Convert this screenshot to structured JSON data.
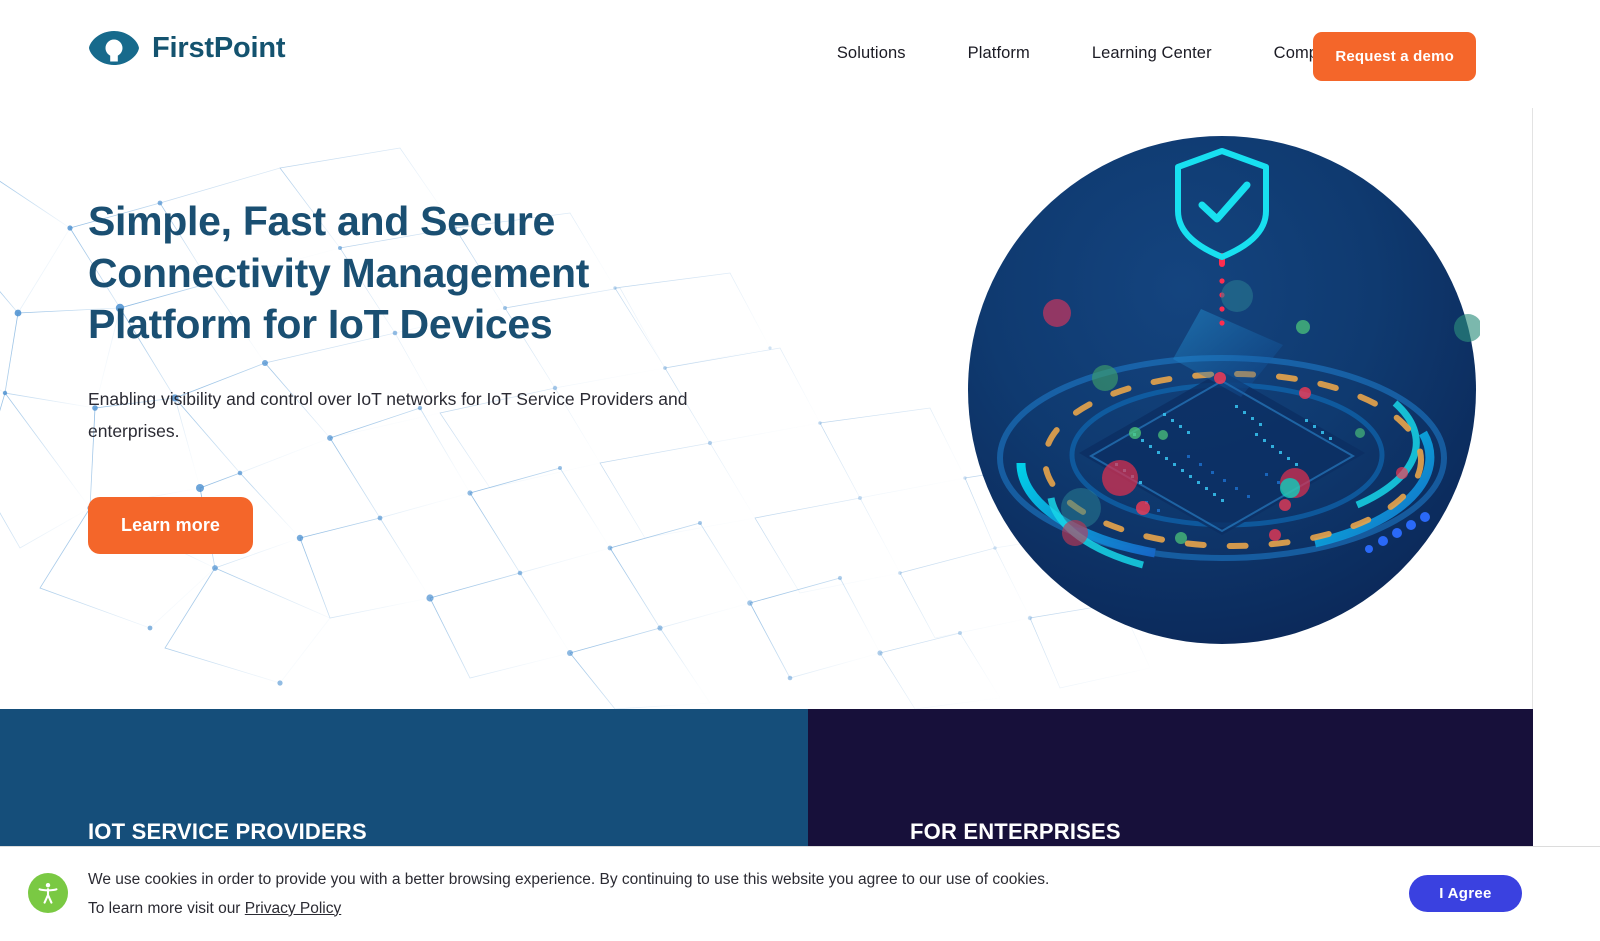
{
  "brand": {
    "name": "FirstPoint",
    "logo_icon": "eye-lens-icon",
    "color": "#14536f"
  },
  "header": {
    "nav_items": [
      {
        "label": "Solutions"
      },
      {
        "label": "Platform"
      },
      {
        "label": "Learning Center"
      },
      {
        "label": "Company"
      }
    ],
    "cta_label": "Request a demo",
    "cta_color": "#f4662a"
  },
  "hero": {
    "title_lines": [
      "Simple, Fast and Secure",
      "Connectivity Management",
      "Platform for IoT Devices"
    ],
    "title_color": "#1a4f72",
    "subtitle": "Enabling visibility and control over IoT networks for IoT Service Providers and enterprises.",
    "cta_label": "Learn more",
    "cta_color": "#f4662a",
    "artwork_icon": "iot-security-shield-illustration"
  },
  "panels": [
    {
      "title": "IOT SERVICE PROVIDERS",
      "background": "#154e7a"
    },
    {
      "title": "FOR ENTERPRISES",
      "background": "#17103a"
    }
  ],
  "cookie_banner": {
    "accessibility_icon": "accessibility-person-icon",
    "accessibility_color": "#7ac943",
    "line1": "We use cookies in order to provide you with a better browsing experience. By continuing to use this website you agree to our use of cookies.",
    "line2_prefix": "To learn more visit our ",
    "privacy_link_label": "Privacy Policy",
    "agree_label": "I Agree",
    "agree_color": "#3a41e0"
  }
}
